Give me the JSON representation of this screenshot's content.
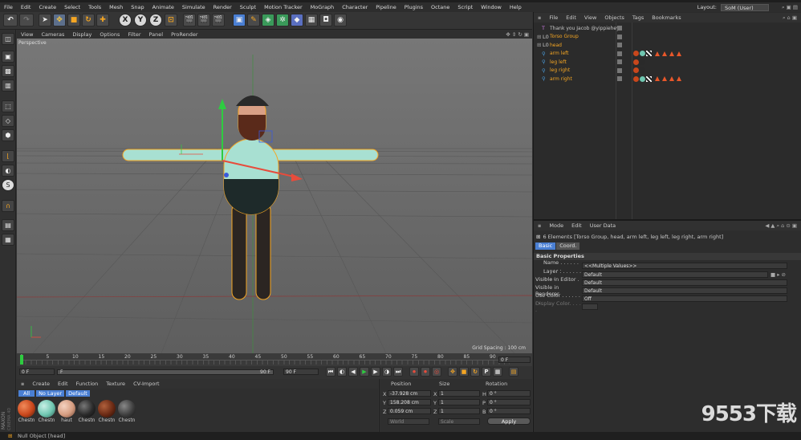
{
  "app": {
    "title": "Cinema 4D",
    "layout_label": "Layout:",
    "layout_value": "SoM (User)"
  },
  "menubar": [
    "File",
    "Edit",
    "Create",
    "Select",
    "Tools",
    "Mesh",
    "Snap",
    "Animate",
    "Simulate",
    "Render",
    "Sculpt",
    "Motion Tracker",
    "MoGraph",
    "Character",
    "Pipeline",
    "Plugins",
    "Octane",
    "Script",
    "Window",
    "Help"
  ],
  "toolbar": {
    "x_axis": "X",
    "y_axis": "Y",
    "z_axis": "Z"
  },
  "viewport": {
    "menu": [
      "View",
      "Cameras",
      "Display",
      "Options",
      "Filter",
      "Panel",
      "ProRender"
    ],
    "label": "Perspective",
    "grid_spacing": "Grid Spacing : 100 cm"
  },
  "timeline": {
    "ticks": [
      "0",
      "5",
      "10",
      "15",
      "20",
      "25",
      "30",
      "35",
      "40",
      "45",
      "50",
      "55",
      "60",
      "65",
      "70",
      "75",
      "80",
      "85",
      "90"
    ],
    "current_frame": "0 F",
    "start": "0 F",
    "slider_start": "F",
    "slider_end": "90 F",
    "end": "90 F"
  },
  "material_manager": {
    "menu": [
      "Create",
      "Edit",
      "Function",
      "Texture",
      "CV-Import"
    ],
    "filters": [
      "All",
      "No Layer",
      "Default"
    ],
    "materials": [
      {
        "name": "Chestn",
        "color": "#c9471c"
      },
      {
        "name": "Chestn",
        "color": "#6fc6b0"
      },
      {
        "name": "haut",
        "color": "#d49c80"
      },
      {
        "name": "Chestn",
        "color": "#2a2a2a"
      },
      {
        "name": "Chestn",
        "color": "#6a2a14"
      },
      {
        "name": "Chestn",
        "color": "#3f3f3f"
      }
    ]
  },
  "coordinates": {
    "headers": [
      "Position",
      "Size",
      "Rotation"
    ],
    "rows": [
      {
        "axis": "X",
        "pos": "-37.928 cm",
        "size_axis": "X",
        "size": "1",
        "rot_axis": "H",
        "rot": "0 °"
      },
      {
        "axis": "Y",
        "pos": "158.208 cm",
        "size_axis": "Y",
        "size": "1",
        "rot_axis": "P",
        "rot": "0 °"
      },
      {
        "axis": "Z",
        "pos": "0.059 cm",
        "size_axis": "Z",
        "size": "1",
        "rot_axis": "B",
        "rot": "0 °"
      }
    ],
    "mode1": "World",
    "mode2": "Scale",
    "apply": "Apply"
  },
  "object_manager": {
    "menu": [
      "File",
      "Edit",
      "View",
      "Objects",
      "Tags",
      "Bookmarks"
    ],
    "objects": [
      {
        "name": "Thank you Jacob @yippiehey",
        "color": "#c8c8c8"
      },
      {
        "name": "Torso Group",
        "color": "#f5a623"
      },
      {
        "name": "head",
        "color": "#f5a623"
      },
      {
        "name": "arm left",
        "color": "#f5a623"
      },
      {
        "name": "leg left",
        "color": "#f5a623"
      },
      {
        "name": "leg right",
        "color": "#f5a623"
      },
      {
        "name": "arm right",
        "color": "#f5a623"
      }
    ]
  },
  "attribute_manager": {
    "menu": [
      "Mode",
      "Edit",
      "User Data"
    ],
    "selection": "6 Elements [Torso Group, head, arm left, leg left, leg right, arm right]",
    "tabs": [
      "Basic",
      "Coord."
    ],
    "section": "Basic Properties",
    "props": [
      {
        "label": "Name . . . . . . . . . . . .",
        "value": "<<Multiple Values>>"
      },
      {
        "label": "Layer . . . . . . . . . . .",
        "value": "Default"
      },
      {
        "label": "Visible in Editor . . .",
        "value": "Default"
      },
      {
        "label": "Visible in Renderer",
        "value": "Default"
      },
      {
        "label": "Use Color . . . . . . . .",
        "value": "Off"
      },
      {
        "label": "Display Color. . . . .",
        "value": ""
      }
    ]
  },
  "status": {
    "text": "Null Object [head]"
  },
  "brand": {
    "maxon": "MAXON",
    "product": "CINEMA 4D",
    "watermark": "9553下载"
  },
  "colors": {
    "accent": "#f5a623",
    "selection_blue": "#4a7fd3"
  }
}
